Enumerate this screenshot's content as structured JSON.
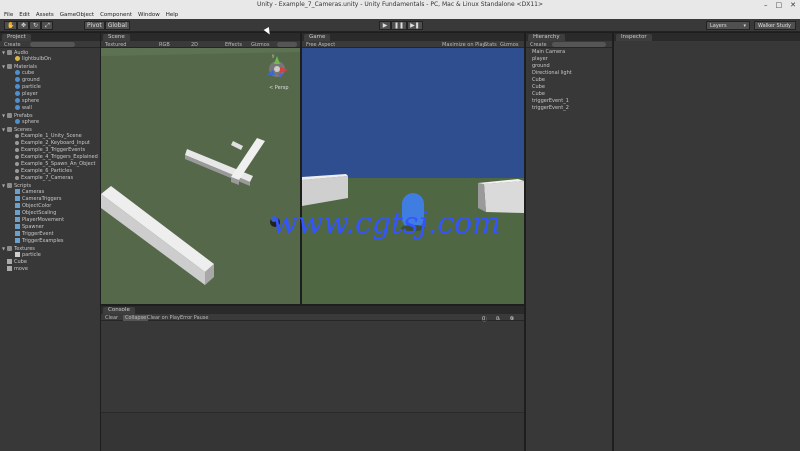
{
  "window": {
    "title": "Unity - Example_7_Cameras.unity - Unity Fundamentals - PC, Mac & Linux Standalone <DX11>"
  },
  "menu": [
    "File",
    "Edit",
    "Assets",
    "GameObject",
    "Component",
    "Window",
    "Help"
  ],
  "toolbar": {
    "pivot": "Pivot",
    "global": "Global",
    "layers": "Layers",
    "layout": "Walker Study"
  },
  "project": {
    "tab": "Project",
    "create": "Create",
    "items": [
      {
        "label": "Audio",
        "icon": "folder",
        "indent": 0,
        "arrow": "▼"
      },
      {
        "label": "lightbulbOn",
        "icon": "bulb",
        "indent": 1
      },
      {
        "label": "Materials",
        "icon": "folder",
        "indent": 0,
        "arrow": "▼"
      },
      {
        "label": "cube",
        "icon": "ball",
        "indent": 1
      },
      {
        "label": "ground",
        "icon": "ball",
        "indent": 1
      },
      {
        "label": "particle",
        "icon": "ball",
        "indent": 1
      },
      {
        "label": "player",
        "icon": "ball",
        "indent": 1
      },
      {
        "label": "sphere",
        "icon": "ball",
        "indent": 1
      },
      {
        "label": "wall",
        "icon": "ball",
        "indent": 1
      },
      {
        "label": "Prefabs",
        "icon": "folder",
        "indent": 0,
        "arrow": "▼"
      },
      {
        "label": "sphere",
        "icon": "ball",
        "indent": 1
      },
      {
        "label": "Scenes",
        "icon": "folder",
        "indent": 0,
        "arrow": "▼"
      },
      {
        "label": "Example_1_Unity_Scene",
        "icon": "scene",
        "indent": 1
      },
      {
        "label": "Example_2_Keyboard_Input",
        "icon": "scene",
        "indent": 1
      },
      {
        "label": "Example_3_TriggerEvents",
        "icon": "scene",
        "indent": 1
      },
      {
        "label": "Example_4_Triggers_Explained",
        "icon": "scene",
        "indent": 1
      },
      {
        "label": "Example_5_Spawn_An_Object",
        "icon": "scene",
        "indent": 1
      },
      {
        "label": "Example_6_Particles",
        "icon": "scene",
        "indent": 1
      },
      {
        "label": "Example_7_Cameras",
        "icon": "scene",
        "indent": 1
      },
      {
        "label": "Scripts",
        "icon": "folder",
        "indent": 0,
        "arrow": "▼"
      },
      {
        "label": "Cameras",
        "icon": "script",
        "indent": 1
      },
      {
        "label": "CameraTriggers",
        "icon": "script",
        "indent": 1
      },
      {
        "label": "ObjectColor",
        "icon": "script",
        "indent": 1
      },
      {
        "label": "ObjectScaling",
        "icon": "script",
        "indent": 1
      },
      {
        "label": "PlayerMovement",
        "icon": "script",
        "indent": 1
      },
      {
        "label": "Spawner",
        "icon": "script",
        "indent": 1
      },
      {
        "label": "TriggerEvent",
        "icon": "script",
        "indent": 1
      },
      {
        "label": "TriggerExamples",
        "icon": "script",
        "indent": 1
      },
      {
        "label": "Textures",
        "icon": "folder",
        "indent": 0,
        "arrow": "▼"
      },
      {
        "label": "particle",
        "icon": "tex",
        "indent": 1
      },
      {
        "label": "Cube",
        "icon": "cube",
        "indent": 0
      },
      {
        "label": "move",
        "icon": "cube",
        "indent": 0
      }
    ]
  },
  "scene": {
    "tab": "Scene",
    "shading": "Textured",
    "render": "RGB",
    "mode2d": "2D",
    "effects": "Effects",
    "gizmos": "Gizmos",
    "persp": "< Persp"
  },
  "game": {
    "tab": "Game",
    "aspect": "Free Aspect",
    "maximize": "Maximize on Play",
    "stats": "Stats",
    "gizmos": "Gizmos"
  },
  "hierarchy": {
    "tab": "Hierarchy",
    "create": "Create",
    "items": [
      "Main Camera",
      "player",
      "ground",
      "Directional light",
      "Cube",
      "Cube",
      "Cube",
      "triggerEvent_1",
      "triggerEvent_2"
    ]
  },
  "inspector": {
    "tab": "Inspector"
  },
  "console": {
    "tab": "Console",
    "clear": "Clear",
    "collapse": "Collapse",
    "clear_on_play": "Clear on Play",
    "error_pause": "Error Pause",
    "count_info": "0",
    "count_warn": "0",
    "count_error": "0"
  },
  "watermark": "www.cgtsj.com"
}
